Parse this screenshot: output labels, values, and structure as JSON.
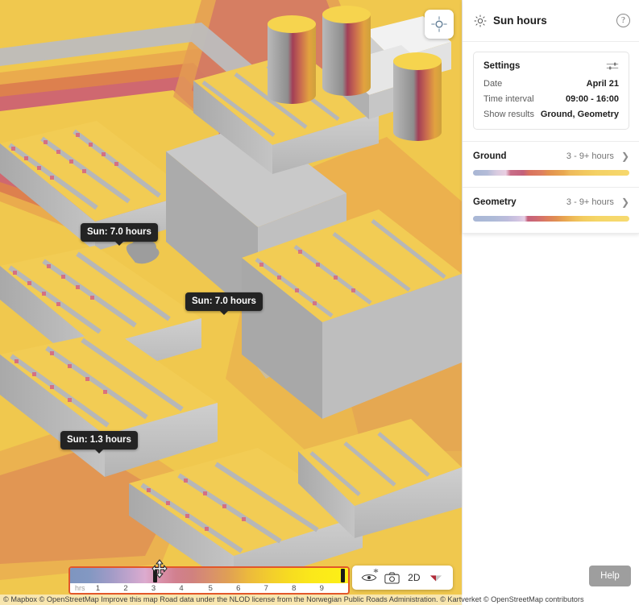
{
  "app": {
    "title": "Sun hours"
  },
  "map": {
    "recenter_icon": "crosshair-target-icon",
    "tooltips": [
      {
        "label": "Sun: 7.0 hours",
        "hours": 7.0
      },
      {
        "label": "Sun: 7.0 hours",
        "hours": 7.0
      },
      {
        "label": "Sun: 1.3 hours",
        "hours": 1.3
      }
    ],
    "controls": [
      {
        "name": "visibility",
        "icon": "eye-icon",
        "label": ""
      },
      {
        "name": "screenshot",
        "icon": "camera-icon",
        "label": ""
      },
      {
        "name": "view-mode",
        "icon": "",
        "label": "2D"
      },
      {
        "name": "compass",
        "icon": "compass-needle-icon",
        "label": ""
      }
    ],
    "attribution": "© Mapbox © OpenStreetMap Improve this map Road data under the NLOD license from the Norwegian Public Roads Administration. © Kartverket © OpenStreetMap contributors"
  },
  "sidebar": {
    "header": {
      "icon": "sun-icon",
      "title": "Sun hours",
      "help_icon": "question-mark-icon",
      "help_label": "?"
    },
    "settings": {
      "title": "Settings",
      "sliders_icon": "sliders-icon",
      "rows": [
        {
          "key": "Date",
          "value": "April 21"
        },
        {
          "key": "Time interval",
          "value": "09:00 - 16:00"
        },
        {
          "key": "Show results",
          "value": "Ground, Geometry"
        }
      ]
    },
    "layers": [
      {
        "name": "Ground",
        "range": "3 - 9+ hours",
        "chevron": "chevron-right-icon"
      },
      {
        "name": "Geometry",
        "range": "3 - 9+ hours",
        "chevron": "chevron-right-icon"
      }
    ]
  },
  "help_button": {
    "label": "Help"
  },
  "chart_data": {
    "type": "heatmap",
    "title": "Sun hours legend",
    "xlabel": "hrs",
    "unit_label": "hrs",
    "categories": [
      "1",
      "2",
      "3",
      "4",
      "5",
      "6",
      "7",
      "8",
      "9"
    ],
    "tick_positions_pct": [
      10,
      22.4,
      34.8,
      47.2,
      59.6,
      72,
      84.4,
      96.8,
      109.2
    ],
    "axis_range": [
      0,
      9
    ],
    "selected_range": [
      3,
      9
    ],
    "handles": [
      {
        "name": "lower-handle",
        "value": 3,
        "pos_pct": 30.5
      },
      {
        "name": "upper-handle",
        "value": 9,
        "pos_pct": 97.8
      }
    ],
    "colors": [
      "#7e95c0",
      "#9e9ac6",
      "#bfa3cc",
      "#dcabcf",
      "#d98fa8",
      "#d0817f",
      "#d88f6d",
      "#e0a054",
      "#ecb93d",
      "#f7dc20",
      "#fdf016"
    ],
    "grid": false,
    "legend_position": "bottom-left"
  }
}
